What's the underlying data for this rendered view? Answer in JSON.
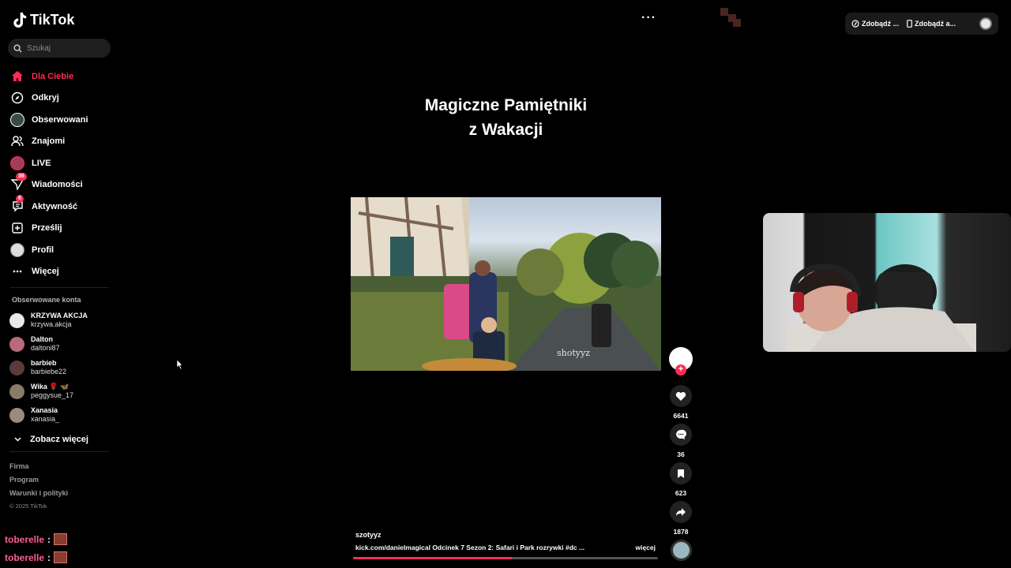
{
  "app": {
    "name": "TikTok"
  },
  "search": {
    "placeholder": "Szukaj"
  },
  "nav": [
    {
      "label": "Dla Ciebie",
      "icon": "home-icon",
      "active": true
    },
    {
      "label": "Odkryj",
      "icon": "compass-icon"
    },
    {
      "label": "Obserwowani",
      "icon": "following-avatar-icon"
    },
    {
      "label": "Znajomi",
      "icon": "friends-icon"
    },
    {
      "label": "LIVE",
      "icon": "live-avatar-icon"
    },
    {
      "label": "Wiadomości",
      "icon": "paper-plane-icon",
      "badge": "36"
    },
    {
      "label": "Aktywność",
      "icon": "activity-icon",
      "badge": "6"
    },
    {
      "label": "Prześlij",
      "icon": "upload-icon"
    },
    {
      "label": "Profil",
      "icon": "profile-avatar-icon"
    },
    {
      "label": "Więcej",
      "icon": "more-dots-icon"
    }
  ],
  "following_section": {
    "label": "Obserwowane konta",
    "accounts": [
      {
        "name": "KRZYWA AKCJA",
        "username": "krzywa.akcja",
        "color": "#e8e8e8"
      },
      {
        "name": "Dalton",
        "username": "daltoni87",
        "color": "#b86a7c"
      },
      {
        "name": "barbieb",
        "username": "barbiebe22",
        "color": "#5a3a3a"
      },
      {
        "name": "Wika 🌹 🦋",
        "username": "peggysue_17",
        "color": "#8a7a6a"
      },
      {
        "name": "Xanasia",
        "username": "xanasia_",
        "color": "#9a8a80"
      }
    ],
    "see_more": "Zobacz więcej"
  },
  "footer": {
    "links": [
      "Firma",
      "Program",
      "Warunki i polityki"
    ],
    "copyright": "© 2025 TikTok"
  },
  "chat": [
    {
      "user": "toberelle",
      "sep": ":"
    },
    {
      "user": "toberelle",
      "sep": ":"
    }
  ],
  "header": {
    "more": "···",
    "coins": "Zdobądź ...",
    "app": "Zdobądź a..."
  },
  "video": {
    "title_line1": "Magiczne Pamiętniki",
    "title_line2": "z Wakacji",
    "watermark": "shotyyz",
    "author": "szotyyz",
    "description": "kick.com/danielmagical Odcinek 7 Sezon 2: Safari i Park rozrywki #dc ...",
    "more_label": "więcej",
    "progress": 0.52
  },
  "actions": {
    "likes": "6641",
    "comments": "36",
    "saves": "623",
    "shares": "1878"
  },
  "colors": {
    "accent": "#fe2c55",
    "background": "#000000"
  }
}
